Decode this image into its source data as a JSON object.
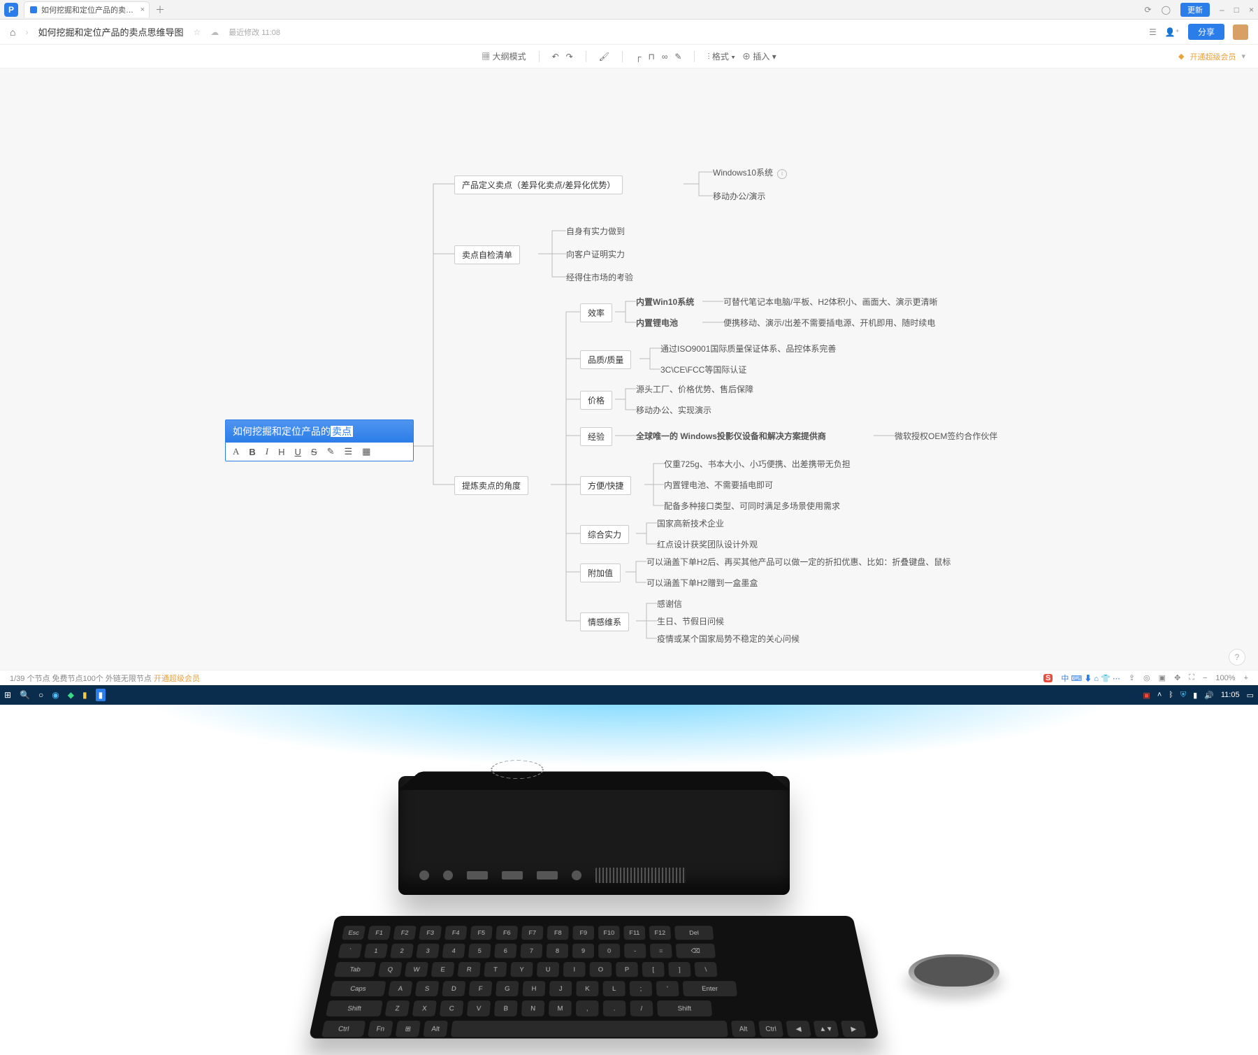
{
  "chrome": {
    "tab_title": "如何挖掘和定位产品的卖…",
    "refresh_btn": "更新",
    "window_min": "–",
    "window_max": "□",
    "window_close": "×"
  },
  "doc_header": {
    "title": "如何挖掘和定位产品的卖点思维导图",
    "meta": "最近修改 11:08",
    "share": "分享"
  },
  "toolbar": {
    "outline_mode": "大纲模式",
    "format": "格式",
    "insert": "插入",
    "upgrade": "开通超级会员"
  },
  "root": {
    "text_prefix": "如何挖掘和定位产品的",
    "text_highlight": "卖点",
    "bold": "A",
    "b": "B",
    "i": "I",
    "h": "H",
    "u": "U",
    "s": "S"
  },
  "nodes": {
    "n1": "产品定义卖点（差异化卖点/差异化优势）",
    "n1_c1": "Windows10系统",
    "n1_c2": "移动办公/演示",
    "n2": "卖点自检清单",
    "n2_c1": "自身有实力做到",
    "n2_c2": "向客户证明实力",
    "n2_c3": "经得住市场的考验",
    "n3": "提炼卖点的角度",
    "n3_1": "效率",
    "n3_1_a": "内置Win10系统",
    "n3_1_a_d": "可替代笔记本电脑/平板、H2体积小、画面大、演示更清晰",
    "n3_1_b": "内置锂电池",
    "n3_1_b_d": "便携移动、演示/出差不需要插电源、开机即用、随时续电",
    "n3_2": "品质/质量",
    "n3_2_a": "通过ISO9001国际质量保证体系、品控体系完善",
    "n3_2_b": "3C\\CE\\FCC等国际认证",
    "n3_3": "价格",
    "n3_3_a": "源头工厂、价格优势、售后保障",
    "n3_3_b": "移动办公、实现演示",
    "n3_4": "经验",
    "n3_4_a": "全球唯一的 Windows投影仪设备和解决方案提供商",
    "n3_4_a_d": "微软授权OEM签约合作伙伴",
    "n3_5": "方便/快捷",
    "n3_5_a": "仅重725g、书本大小、小巧便携、出差携带无负担",
    "n3_5_b": "内置锂电池、不需要插电即可",
    "n3_5_c": "配备多种接口类型、可同时满足多场景使用需求",
    "n3_6": "综合实力",
    "n3_6_a": "国家高新技术企业",
    "n3_6_b": "红点设计获奖团队设计外观",
    "n3_7": "附加值",
    "n3_7_a": "可以涵盖下单H2后、再买其他产品可以做一定的折扣优惠、比如：折叠键盘、鼠标",
    "n3_7_b": "可以涵盖下单H2赠到一盒墨盒",
    "n3_8": "情感维系",
    "n3_8_a": "感谢信",
    "n3_8_b": "生日、节假日问候",
    "n3_8_c": "疫情或某个国家局势不稳定的关心问候"
  },
  "status": {
    "left_info": "1/39 个节点  免费节点100个  外链无限节点",
    "left_upgrade": "开通超级会员",
    "zoom": "100%"
  },
  "taskbar": {
    "time": "11:05"
  }
}
